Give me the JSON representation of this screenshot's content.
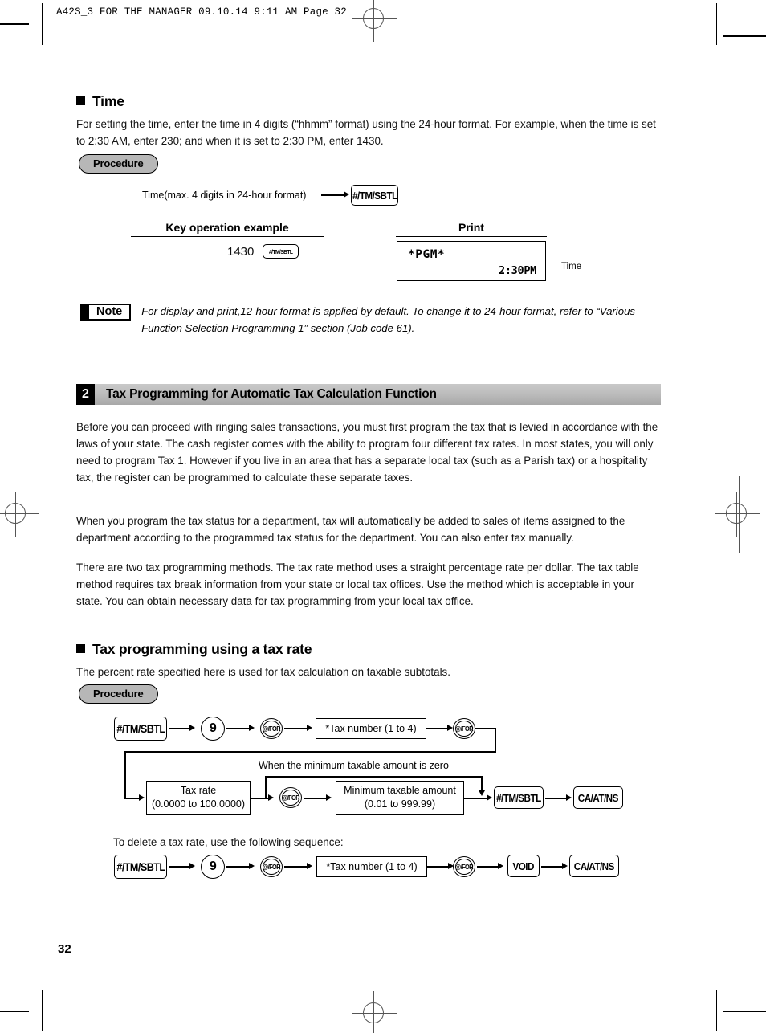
{
  "header": {
    "text": "A42S_3 FOR THE MANAGER  09.10.14 9:11 AM  Page 32"
  },
  "time_section": {
    "heading": "Time",
    "paragraph": "For setting the time, enter the time in 4 digits (“hhmm” format) using the 24-hour format.  For example, when the time is set to 2:30 AM, enter 230; and when it is set to 2:30 PM, enter 1430.",
    "procedure_label": "Procedure",
    "flow_caption": "Time(max. 4 digits in 24-hour format)",
    "flow_key": "#/TM/SBTL",
    "col_key_operation": "Key operation example",
    "col_print": "Print",
    "example_value": "1430",
    "example_key": "#/TM/SBTL",
    "receipt": {
      "line1": "*PGM*",
      "line2": "2:30PM",
      "callout": "Time"
    }
  },
  "note": {
    "badge": "Note",
    "text": "For display and print,12-hour format is applied by default.  To change it to 24-hour format, refer to “Various Function Selection Programming 1” section (Job code 61)."
  },
  "section2": {
    "number": "2",
    "title": "Tax Programming for Automatic Tax Calculation Function",
    "paragraphs": [
      "Before you can proceed with ringing sales transactions, you must first program the tax that is levied in accordance with the laws of your state.  The cash register comes with the ability to program four different tax rates.  In most states, you will only need to program Tax 1.  However if you live in an area that has a separate local tax (such as a Parish tax) or a hospitality tax, the register can be programmed to calculate these separate taxes.",
      "When you program the tax status for a department, tax will automatically be added to sales of items assigned to the department according to the programmed tax status for the department.  You can also enter tax manually.",
      "There are two tax programming methods.  The tax rate method uses a straight percentage rate per dollar.  The tax table method requires tax break information from your state or local tax offices.  Use the method which is acceptable in your state.  You can obtain necessary data for tax programming from your local tax office."
    ]
  },
  "tax_rate_section": {
    "heading": "Tax programming using a tax rate",
    "paragraph": "The percent rate specified here is used for tax calculation on taxable subtotals.",
    "procedure_label": "Procedure",
    "flow": {
      "key_tm_sbtl": "#/TM/SBTL",
      "digit_9": "9",
      "key_at_for": "@/FOR",
      "tax_number_box": "*Tax number (1 to 4)",
      "key_at_for_2": "@/FOR",
      "bypass_label": "When the minimum taxable amount is zero",
      "tax_rate_box_line1": "Tax rate",
      "tax_rate_box_line2": "(0.0000 to 100.0000)",
      "key_at_for_3": "@/FOR",
      "min_amount_box_line1": "Minimum taxable amount",
      "min_amount_box_line2": "(0.01 to 999.99)",
      "key_tm_sbtl_2": "#/TM/SBTL",
      "key_ca_at_ns": "CA/AT/NS"
    },
    "delete_intro": "To delete a tax rate, use the following sequence:",
    "delete_flow": {
      "key_tm_sbtl": "#/TM/SBTL",
      "digit_9": "9",
      "key_at_for": "@/FOR",
      "tax_number_box": "*Tax number (1 to 4)",
      "key_at_for_2": "@/FOR",
      "key_void": "VOID",
      "key_ca_at_ns": "CA/AT/NS"
    }
  },
  "footer": {
    "page_number": "32"
  }
}
